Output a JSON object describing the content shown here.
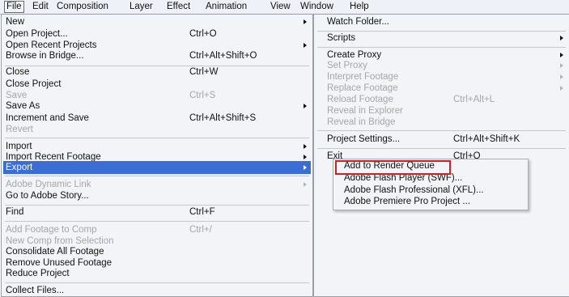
{
  "menubar": {
    "file": "File",
    "edit": "Edit",
    "composition": "Composition",
    "layer": "Layer",
    "effect": "Effect",
    "animation": "Animation",
    "view": "View",
    "window": "Window",
    "help": "Help"
  },
  "file_menu": {
    "new": "New",
    "open_project": "Open Project...",
    "open_project_sc": "Ctrl+O",
    "open_recent": "Open Recent Projects",
    "browse_bridge": "Browse in Bridge...",
    "browse_bridge_sc": "Ctrl+Alt+Shift+O",
    "close": "Close",
    "close_sc": "Ctrl+W",
    "close_project": "Close Project",
    "save": "Save",
    "save_sc": "Ctrl+S",
    "save_as": "Save As",
    "increment_save": "Increment and Save",
    "increment_save_sc": "Ctrl+Alt+Shift+S",
    "revert": "Revert",
    "import": "Import",
    "import_recent": "Import Recent Footage",
    "export": "Export",
    "dynamic_link": "Adobe Dynamic Link",
    "adobe_story": "Go to Adobe Story...",
    "find": "Find",
    "find_sc": "Ctrl+F",
    "add_footage": "Add Footage to Comp",
    "add_footage_sc": "Ctrl+/",
    "new_comp_sel": "New Comp from Selection",
    "consolidate": "Consolidate All Footage",
    "remove_unused": "Remove Unused Footage",
    "reduce_project": "Reduce Project",
    "collect_files": "Collect Files..."
  },
  "file_menu_cont": {
    "watch_folder": "Watch Folder...",
    "scripts": "Scripts",
    "create_proxy": "Create Proxy",
    "set_proxy": "Set Proxy",
    "interpret_footage": "Interpret Footage",
    "replace_footage": "Replace Footage",
    "reload_footage": "Reload Footage",
    "reload_footage_sc": "Ctrl+Alt+L",
    "reveal_explorer": "Reveal in Explorer",
    "reveal_bridge": "Reveal in Bridge",
    "project_settings": "Project Settings...",
    "project_settings_sc": "Ctrl+Alt+Shift+K",
    "exit": "Exit",
    "exit_sc": "Ctrl+Q"
  },
  "export_menu": {
    "render_queue": "Add to Render Queue",
    "flash_player": "Adobe Flash Player (SWF)...",
    "flash_pro": "Adobe Flash Professional (XFL)...",
    "premiere": "Adobe Premiere Pro Project ..."
  }
}
